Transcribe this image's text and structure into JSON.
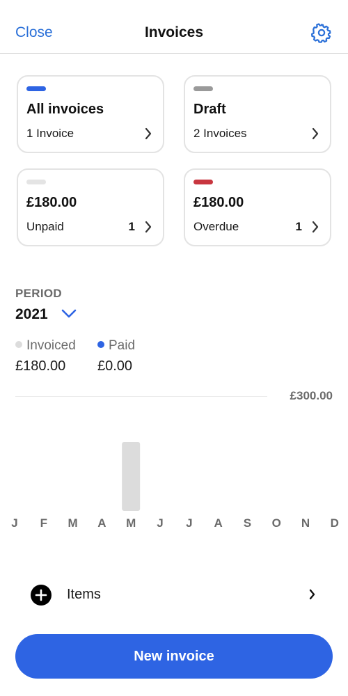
{
  "nav": {
    "close_label": "Close",
    "title": "Invoices",
    "settings_icon": "gear-icon"
  },
  "colors": {
    "accent": "#2e64e3",
    "link": "#2b70d8",
    "draft": "#9a9a9a",
    "unpaid": "#e4e4e4",
    "overdue": "#c8363f",
    "invoiced_dot": "#dcdcdc",
    "paid_dot": "#2e64e3"
  },
  "cards": [
    {
      "title": "All invoices",
      "subtitle": "1 Invoice",
      "count": ""
    },
    {
      "title": "Draft",
      "subtitle": "2 Invoices",
      "count": ""
    },
    {
      "title": "£180.00",
      "subtitle": "Unpaid",
      "count": "1"
    },
    {
      "title": "£180.00",
      "subtitle": "Overdue",
      "count": "1"
    }
  ],
  "period": {
    "label": "PERIOD",
    "value": "2021"
  },
  "legend": {
    "invoiced_label": "Invoiced",
    "invoiced_value": "£180.00",
    "paid_label": "Paid",
    "paid_value": "£0.00"
  },
  "chart_data": {
    "type": "bar",
    "categories": [
      "J",
      "F",
      "M",
      "A",
      "M",
      "J",
      "J",
      "A",
      "S",
      "O",
      "N",
      "D"
    ],
    "series": [
      {
        "name": "Invoiced",
        "values": [
          0,
          0,
          0,
          0,
          180,
          0,
          0,
          0,
          0,
          0,
          0,
          0
        ]
      },
      {
        "name": "Paid",
        "values": [
          0,
          0,
          0,
          0,
          0,
          0,
          0,
          0,
          0,
          0,
          0,
          0
        ]
      }
    ],
    "ylim": [
      0,
      300
    ],
    "max_label": "£300.00"
  },
  "items": {
    "label": "Items"
  },
  "cta": {
    "label": "New invoice"
  }
}
